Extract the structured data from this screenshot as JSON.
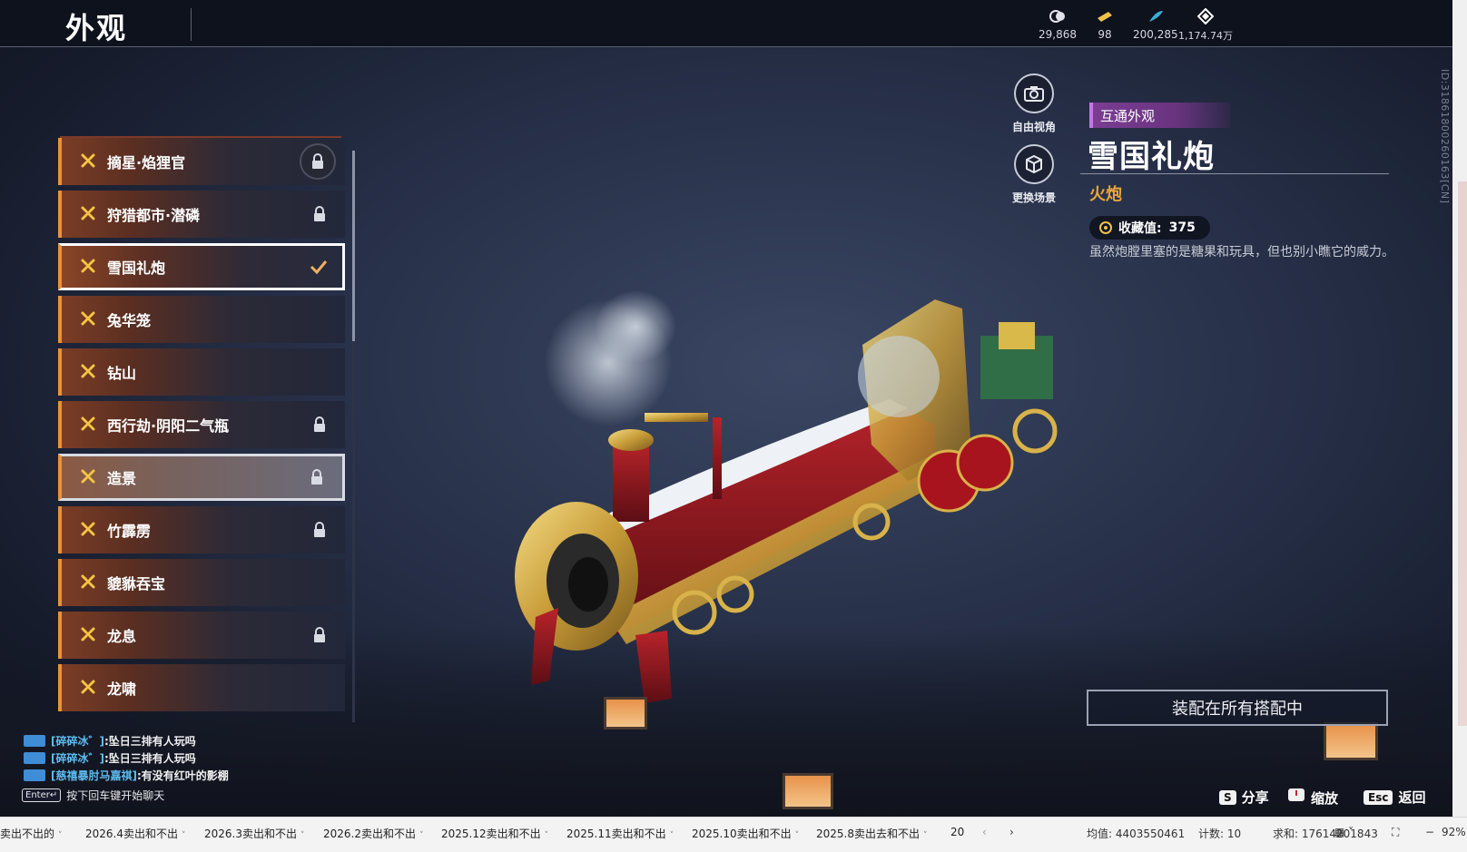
{
  "header": {
    "title": "外观",
    "currencies": [
      {
        "icon": "coin-icon",
        "value": "29,868"
      },
      {
        "icon": "ticket-icon",
        "value": "98"
      },
      {
        "icon": "feather-icon",
        "value": "200,285"
      },
      {
        "icon": "diamond-icon",
        "value": "1,174.74万"
      }
    ]
  },
  "list": {
    "items": [
      {
        "name": "摘星·焰狸官",
        "state": "locked-badge"
      },
      {
        "name": "狩猎都市·潜磷",
        "state": "locked"
      },
      {
        "name": "雪国礼炮",
        "state": "selected"
      },
      {
        "name": "兔华笼",
        "state": "none"
      },
      {
        "name": "钻山",
        "state": "none"
      },
      {
        "name": "西行劫·阴阳二气瓶",
        "state": "locked"
      },
      {
        "name": "造景",
        "state": "hover-locked"
      },
      {
        "name": "竹霹雳",
        "state": "locked"
      },
      {
        "name": "貔貅吞宝",
        "state": "none"
      },
      {
        "name": "龙息",
        "state": "locked"
      },
      {
        "name": "龙啸",
        "state": "none"
      }
    ]
  },
  "side_buttons": {
    "free_view": "自由视角",
    "change_scene": "更换场景"
  },
  "detail": {
    "tag": "互通外观",
    "title": "雪国礼炮",
    "type": "火炮",
    "collect_label": "收藏值:",
    "collect_value": "375",
    "description": "虽然炮膛里塞的是糖果和玩具，但也别小瞧它的威力。",
    "equip_button": "装配在所有搭配中"
  },
  "id_text": "ID:3186180026016​3[CN]",
  "chat": {
    "lines": [
      {
        "user": "[碎碎冰゛]",
        "msg": ":坠日三排有人玩吗"
      },
      {
        "user": "[碎碎冰゛]",
        "msg": ":坠日三排有人玩吗"
      },
      {
        "user": "[慈禧暴肘马嘉祺]",
        "msg": ":有没有红叶的影棚"
      }
    ],
    "enter_key": "Enter↵",
    "hint": "按下回车键开始聊天"
  },
  "shortcuts": {
    "share_key": "S",
    "share": "分享",
    "zoom": "缩放",
    "back_key": "Esc",
    "back": "返回"
  },
  "statusbar": {
    "tabs": [
      "卖出不出的",
      "2026.4卖出和不出",
      "2026.3卖出和不出",
      "2026.2卖出和不出",
      "2025.12卖出和不出",
      "2025.11卖出和不出",
      "2025.10卖出和不出",
      "2025.8卖出去和不出",
      "20"
    ],
    "avg": "均值: 4403550461",
    "count": "计数: 10",
    "sum": "求和: 17614201843",
    "zoom": "92%"
  },
  "colors": {
    "accent_orange": "#e8923a",
    "type_gold": "#e8a63a",
    "tag_purple": "#7a3d92",
    "chat_user": "#5cbcf2"
  }
}
